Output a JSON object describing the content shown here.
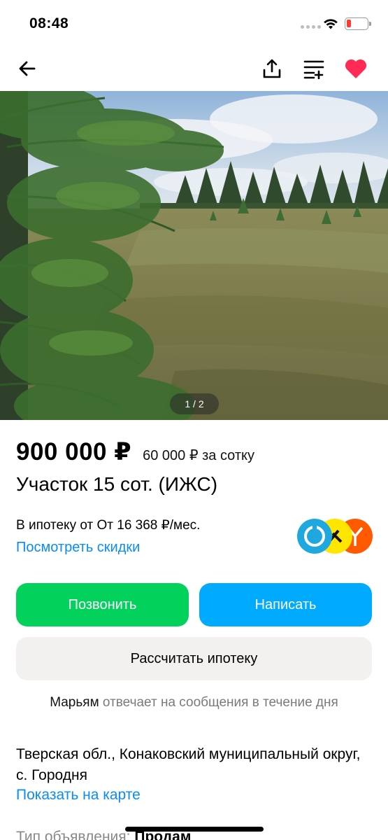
{
  "status": {
    "time": "08:48"
  },
  "nav": {
    "back_icon": "arrow-left-icon",
    "share_icon": "share-icon",
    "compare_icon": "compare-icon",
    "favorite_icon": "heart-icon",
    "favorite_color": "#ff2a55"
  },
  "gallery": {
    "counter": "1 / 2"
  },
  "listing": {
    "price": "900 000 ₽",
    "price_per_unit": "60 000 ₽ за сотку",
    "title": "Участок 15 сот. (ИЖС)"
  },
  "mortgage": {
    "text": "В ипотеку от От 16 368 ₽/мес.",
    "discounts_link": "Посмотреть скидки"
  },
  "actions": {
    "call_label": "Позвонить",
    "write_label": "Написать",
    "calc_mortgage_label": "Рассчитать ипотеку",
    "call_color": "#02d15c",
    "write_color": "#00aaff"
  },
  "seller": {
    "name": "Марьям",
    "response_text": "отвечает на сообщения в течение дня"
  },
  "location": {
    "address": "Тверская обл., Конаковский муниципальный округ, с. Городня",
    "map_link": "Показать на карте"
  },
  "details": {
    "ad_type_label": "Тип объявления:",
    "ad_type_value": "Продам"
  },
  "colors": {
    "link": "#0a8df2"
  }
}
